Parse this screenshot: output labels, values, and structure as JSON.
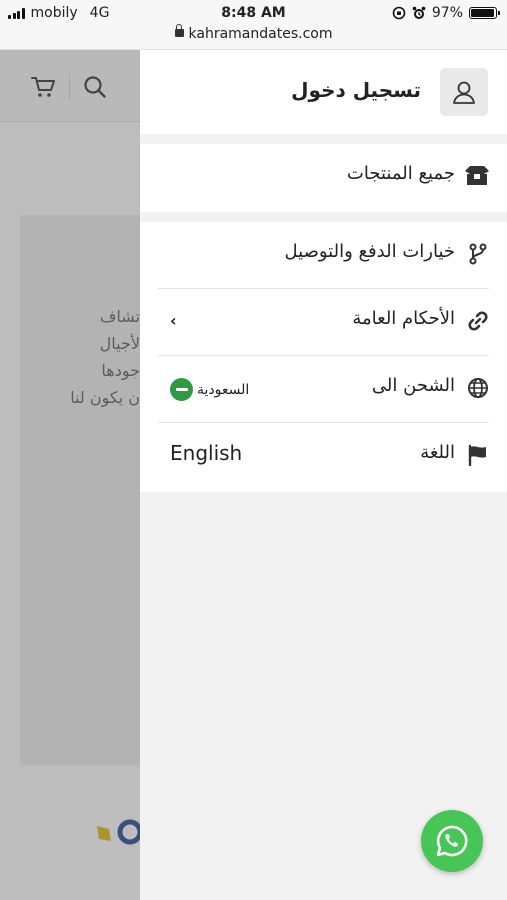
{
  "status_bar": {
    "carrier": "mobily",
    "network": "4G",
    "time": "8:48 AM",
    "battery": "97%",
    "battery_level": 0.97
  },
  "browser": {
    "url": "kahramandates.com"
  },
  "background_page": {
    "text_lines": [
      "تشاف",
      "لأجيال",
      "جودها",
      "ن يكون لنا"
    ]
  },
  "drawer": {
    "login_label": "تسجيل دخول",
    "all_products": "جميع المنتجات",
    "menu": {
      "payment_delivery": "خيارات الدفع والتوصيل",
      "terms": "الأحكام العامة",
      "shipping_to": "الشحن الى",
      "shipping_country": "السعودية",
      "language": "اللغة",
      "language_value": "English"
    }
  },
  "colors": {
    "whatsapp": "#47c557",
    "saudi_flag": "#2e9a45",
    "drawer_bg": "#f2f2f2",
    "overlay": "#bdbdbd"
  },
  "icons": [
    "user-icon",
    "box-icon",
    "fork-icon",
    "link-icon",
    "globe-icon",
    "flag-icon",
    "cart-icon",
    "search-icon",
    "whatsapp-icon"
  ]
}
